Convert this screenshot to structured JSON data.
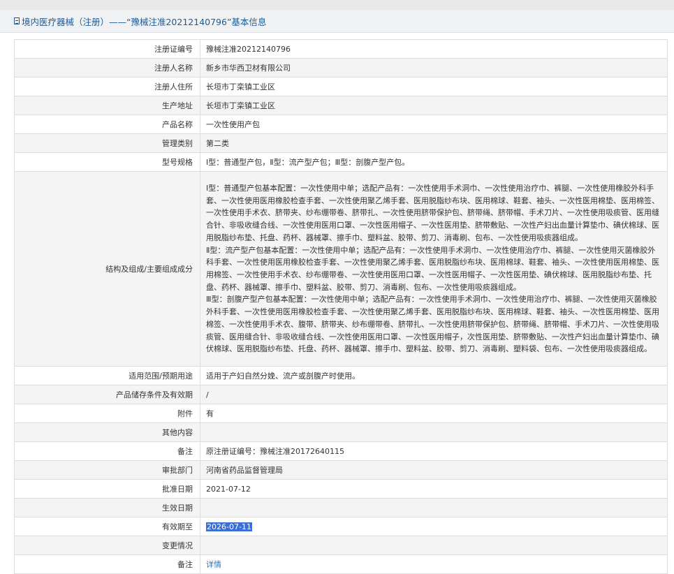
{
  "header": {
    "title": "境内医疗器械（注册）——“豫械注准20212140796”基本信息"
  },
  "rows": [
    {
      "label": "注册证编号",
      "value": "豫械注准20212140796"
    },
    {
      "label": "注册人名称",
      "value": "新乡市华西卫材有限公司"
    },
    {
      "label": "注册人住所",
      "value": "长垣市丁栾镇工业区"
    },
    {
      "label": "生产地址",
      "value": "长垣市丁栾镇工业区"
    },
    {
      "label": "产品名称",
      "value": "一次性使用产包"
    },
    {
      "label": "管理类别",
      "value": "第二类"
    },
    {
      "label": "型号规格",
      "value": "Ⅰ型：普通型产包，Ⅱ型：流产型产包；Ⅲ型：剖腹产型产包。"
    },
    {
      "label": "结构及组成/主要组成成分",
      "paragraphs": [
        "Ⅰ型：普通型产包基本配置：一次性使用中单；选配产品有：一次性使用手术洞巾、一次性使用治疗巾、裤腿、一次性使用橡胶外科手套、一次性使用医用橡胶检查手套、一次性使用聚乙烯手套、医用脱脂纱布块、医用棉球、鞋套、袖头、一次性医用棉垫、医用棉签、一次性使用手术衣、脐带夹、纱布绷带卷、脐带扎、一次性使用脐带保护包、脐带绳、脐带帽、手术刀片、一次性使用吸痰管、医用缝合针、非吸收缝合线、一次性使用医用口罩、一次性医用帽子、一次性医用垫、脐带敷贴、一次性产妇出血量计算垫巾、碘伏棉球、医用脱脂纱布垫、托盘、药杯、器械罩、擦手巾、塑料盆、胶带、剪刀、消毒刷、包布、一次性使用吸痰器组成。",
        "Ⅱ型：流产型产包基本配置：一次性使用中单；选配产品有：一次性使用手术洞巾、一次性使用治疗巾、裤腿、一次性使用灭菌橡胶外科手套、一次性使用医用橡胶检查手套、一次性使用聚乙烯手套、医用脱脂纱布块、医用棉球、鞋套、袖头、一次性使用医用棉垫、医用棉签、一次性使用手术衣、纱布绷带卷、一次性使用医用口罩、一次性医用帽子、一次性医用垫、碘伏棉球、医用脱脂纱布垫、托盘、药杯、器械罩、擦手巾、塑料盆、胶带、剪刀、消毒刷、包布、一次性使用吸痰器组成。",
        "Ⅲ型：剖腹产型产包基本配置：一次性使用中单；选配产品有：一次性使用手术洞巾、一次性使用治疗巾、裤腿、一次性使用灭菌橡胶外科手套、一次性使用医用橡胶检查手套、一次性使用聚乙烯手套、医用脱脂纱布块、医用棉球、鞋套、袖头、一次性医用棉垫、医用棉签、一次性使用手术衣、腹带、脐带夹、纱布绷带卷、脐带扎、一次性使用脐带保护包、脐带绳、脐带帽、手术刀片、一次性使用吸痰管、医用缝合针、非吸收缝合线、一次性使用医用口罩、一次性医用帽子，次性医用垫、脐带敷贴、一次性产妇出血量计算垫巾、碘伏棉球、医用脱脂纱布垫、托盘、药杯、器械罩、擦手巾、塑料盆、胶带、剪刀、消毒刷、塑料袋、包布、一次性使用吸痰器组成。"
      ]
    },
    {
      "label": "适用范围/预期用途",
      "value": "适用于产妇自然分娩、流产或剖腹产时使用。"
    },
    {
      "label": "产品储存条件及有效期",
      "value": "/"
    },
    {
      "label": "附件",
      "value": "有"
    },
    {
      "label": "其他内容",
      "value": ""
    },
    {
      "label": "备注",
      "value": "原注册证编号：豫械注准20172640115"
    },
    {
      "label": "审批部门",
      "value": "河南省药品监督管理局"
    },
    {
      "label": "批准日期",
      "value": "2021-07-12"
    },
    {
      "label": "生效日期",
      "value": ""
    },
    {
      "label": "有效期至",
      "value": "2026-07-11"
    },
    {
      "label": "变更情况",
      "value": ""
    },
    {
      "label": "备注",
      "value": "详情"
    }
  ]
}
